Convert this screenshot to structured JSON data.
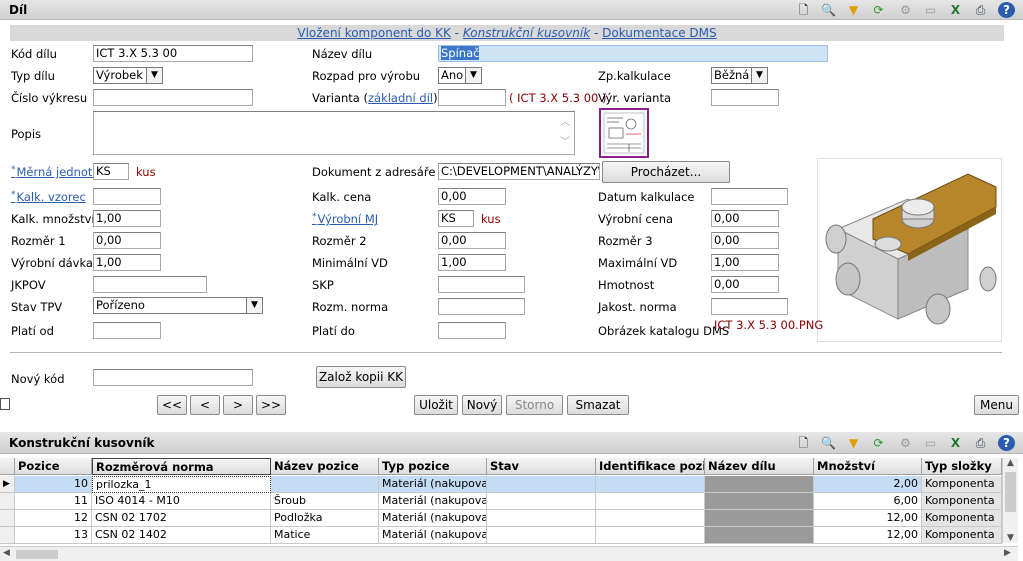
{
  "top_panel": {
    "title": "Díl"
  },
  "link_bar": {
    "insert": "Vložení komponent do KK",
    "sep": " - ",
    "bom": "Konstrukční kusovník",
    "dms": "Dokumentace DMS"
  },
  "fields": {
    "kod_dilu": {
      "label": "Kód dílu",
      "value": "ICT 3.X 5.3 00"
    },
    "nazev_dilu": {
      "label": "Název dílu",
      "value": "Spínač"
    },
    "typ_dilu": {
      "label": "Typ dílu",
      "value": "Výrobek"
    },
    "rozpad": {
      "label": "Rozpad pro výrobu",
      "value": "Ano"
    },
    "zp_kalkulace": {
      "label": "Zp.kalkulace",
      "value": "Běžná"
    },
    "cislo_vykresu": {
      "label": "Číslo výkresu",
      "value": ""
    },
    "varianta": {
      "label_pre": "Varianta (",
      "label_link": "základní díl",
      "label_post": ")",
      "value": "",
      "ref": "( ICT 3.X 5.3 00 )"
    },
    "vyr_varianta": {
      "label": "Výr. varianta",
      "value": ""
    },
    "popis": {
      "label": "Popis",
      "value": ""
    },
    "merna_jednotka": {
      "label": "Měrná jednotka",
      "value": "KS",
      "unit": "kus"
    },
    "dokument": {
      "label": "Dokument z adresáře",
      "value": "C:\\DEVELOPMENT\\ANALÝZY\\KC"
    },
    "kalk_vzorec": {
      "label": "Kalk. vzorec",
      "value": ""
    },
    "kalk_cena": {
      "label": "Kalk. cena",
      "value": "0,00"
    },
    "datum_kalkulace": {
      "label": "Datum kalkulace",
      "value": ""
    },
    "kalk_mnozstvi": {
      "label": "Kalk. množství",
      "value": "1,00"
    },
    "vyrobni_mj": {
      "label": "Výrobní MJ",
      "value": "KS",
      "unit": "kus"
    },
    "vyrobni_cena": {
      "label": "Výrobní cena",
      "value": "0,00"
    },
    "rozmer1": {
      "label": "Rozměr 1",
      "value": "0,00"
    },
    "rozmer2": {
      "label": "Rozměr 2",
      "value": "0,00"
    },
    "rozmer3": {
      "label": "Rozměr 3",
      "value": "0,00"
    },
    "vyrobni_davka": {
      "label": "Výrobní dávka",
      "value": "1,00"
    },
    "min_vd": {
      "label": "Minimální VD",
      "value": "1,00"
    },
    "max_vd": {
      "label": "Maximální VD",
      "value": "1,00"
    },
    "jkpov": {
      "label": "JKPOV",
      "value": ""
    },
    "skp": {
      "label": "SKP",
      "value": ""
    },
    "hmotnost": {
      "label": "Hmotnost",
      "value": "0,00"
    },
    "stav_tpv": {
      "label": "Stav TPV",
      "value": "Pořízeno"
    },
    "rozm_norma": {
      "label": "Rozm. norma",
      "value": ""
    },
    "jakost_norma": {
      "label": "Jakost. norma",
      "value": ""
    },
    "plati_od": {
      "label": "Platí od",
      "value": ""
    },
    "plati_do": {
      "label": "Platí do",
      "value": ""
    },
    "obrazek": {
      "label": "Obrázek katalogu DMS",
      "value": "ICT 3.X 5.3 00.PNG"
    },
    "novy_kod": {
      "label": "Nový kód",
      "value": ""
    }
  },
  "buttons": {
    "prochazet": "Procházet...",
    "zaloz_kopii": "Založ kopii KK",
    "first": "<<",
    "prev": "<",
    "next": ">",
    "last": ">>",
    "ulozit": "Uložit",
    "novy": "Nový",
    "storno": "Storno",
    "smazat": "Smazat",
    "menu": "Menu"
  },
  "bottom_panel": {
    "title": "Konstrukční kusovník"
  },
  "grid": {
    "columns": [
      "Pozice",
      "Rozměrová norma",
      "Název pozice",
      "Typ pozice",
      "Stav",
      "Identifikace pozi",
      "Název dílu",
      "Množství",
      "Typ složky"
    ],
    "rows": [
      [
        "10",
        "prilozka_1",
        "",
        "Materiál (nakupova",
        "",
        "",
        "",
        "2,00",
        "Komponenta"
      ],
      [
        "11",
        "ISO 4014 - M10",
        "Šroub",
        "Materiál (nakupova",
        "",
        "",
        "",
        "6,00",
        "Komponenta"
      ],
      [
        "12",
        "CSN 02 1702",
        "Podložka",
        "Materiál (nakupova",
        "",
        "",
        "",
        "12,00",
        "Komponenta"
      ],
      [
        "13",
        "CSN 02 1402",
        "Matice",
        "Materiál (nakupova",
        "",
        "",
        "",
        "12,00",
        "Komponenta"
      ]
    ]
  },
  "icons": [
    "page-icon",
    "search-icon",
    "filter-icon",
    "refresh-icon",
    "gear-icon",
    "document-icon",
    "excel-icon",
    "print-icon",
    "help-icon"
  ],
  "colors": {
    "accent": "#2a5db0",
    "selected_row": "#c5dcf5",
    "unit_text": "#8b0000",
    "highlight_field": "#cfe3f7"
  }
}
